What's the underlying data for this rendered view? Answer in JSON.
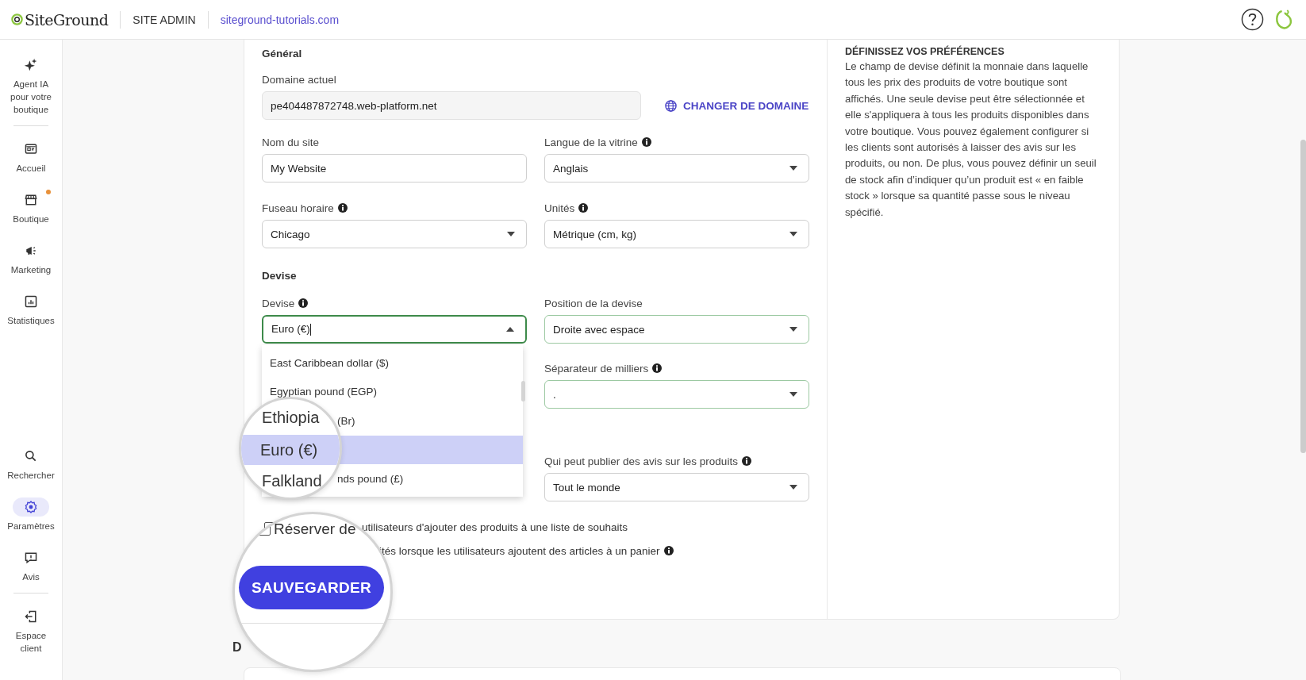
{
  "header": {
    "logo": "SiteGround",
    "section": "SITE ADMIN",
    "site_link": "siteground-tutorials.com"
  },
  "sidebar": {
    "items": [
      {
        "label": "Agent IA pour votre boutique",
        "selected": false,
        "badge": false
      },
      {
        "label": "Accueil",
        "selected": false,
        "badge": false
      },
      {
        "label": "Boutique",
        "selected": false,
        "badge": true
      },
      {
        "label": "Marketing",
        "selected": false,
        "badge": false
      },
      {
        "label": "Statistiques",
        "selected": false,
        "badge": false
      }
    ],
    "bottom_items": [
      {
        "label": "Rechercher",
        "selected": false,
        "badge": false
      },
      {
        "label": "Paramètres",
        "selected": true,
        "badge": false
      },
      {
        "label": "Avis",
        "selected": false,
        "badge": false
      },
      {
        "label": "Espace client",
        "selected": false,
        "badge": false
      }
    ]
  },
  "general": {
    "heading": "Général",
    "domain_label": "Domaine actuel",
    "domain_value": "pe404487872748.web-platform.net",
    "change_domain": "CHANGER DE DOMAINE",
    "fields": [
      {
        "label": "Nom du site",
        "info": false,
        "kind": "text",
        "value": "My Website"
      },
      {
        "label": "Langue de la vitrine",
        "info": true,
        "kind": "select",
        "value": "Anglais"
      },
      {
        "label": "Fuseau horaire",
        "info": true,
        "kind": "select",
        "value": "Chicago"
      },
      {
        "label": "Unités",
        "info": true,
        "kind": "select",
        "value": "Métrique (cm, kg)"
      }
    ]
  },
  "currency": {
    "heading": "Devise",
    "currency_label": "Devise",
    "currency_value": "Euro (€)",
    "expanded": true,
    "options": [
      {
        "text": "East Caribbean dollar ($)",
        "selected": false
      },
      {
        "text": "Egyptian pound (EGP)",
        "selected": false
      },
      {
        "text": "(Br)",
        "selected": false
      },
      {
        "selected": true
      },
      {
        "text": "nds pound (£)",
        "selected": false
      }
    ],
    "right_fields": [
      {
        "label": "Position de la devise",
        "info": false,
        "value": "Droite avec espace"
      },
      {
        "label": "Séparateur de milliers",
        "info": true,
        "value": "."
      },
      {
        "label": "Qui peut publier des avis sur les produits",
        "info": true,
        "value": "Tout le monde"
      }
    ],
    "options_text": [
      {
        "text": "utilisateurs d'ajouter des produits à une liste de souhaits",
        "info": false
      },
      {
        "text": "ités lorsque les utilisateurs ajoutent des articles à un panier",
        "info": true
      }
    ]
  },
  "next_section_heading": "D",
  "info_panel": {
    "title": "DÉFINISSEZ VOS PRÉFÉRENCES",
    "text": "Le champ de devise définit la monnaie dans laquelle tous les prix des produits de votre boutique sont affichés. Une seule devise peut être sélectionnée et elle s'appliquera à tous les produits disponibles dans votre boutique. Vous pouvez également configurer si les clients sont autorisés à laisser des avis sur les produits, ou non. De plus, vous pouvez définir un seuil de stock afin d’indiquer qu’un produit est « en faible stock » lorsque sa quantité passe sous le niveau spécifié."
  },
  "magnifiers": [
    {
      "kind": "dropdown",
      "above": "Ethiopia",
      "highlighted": "Euro (€)",
      "below": "Falkland"
    },
    {
      "kind": "form",
      "checkbox_label": "Réserver de",
      "checked": false,
      "button": "SAUVEGARDER"
    }
  ]
}
